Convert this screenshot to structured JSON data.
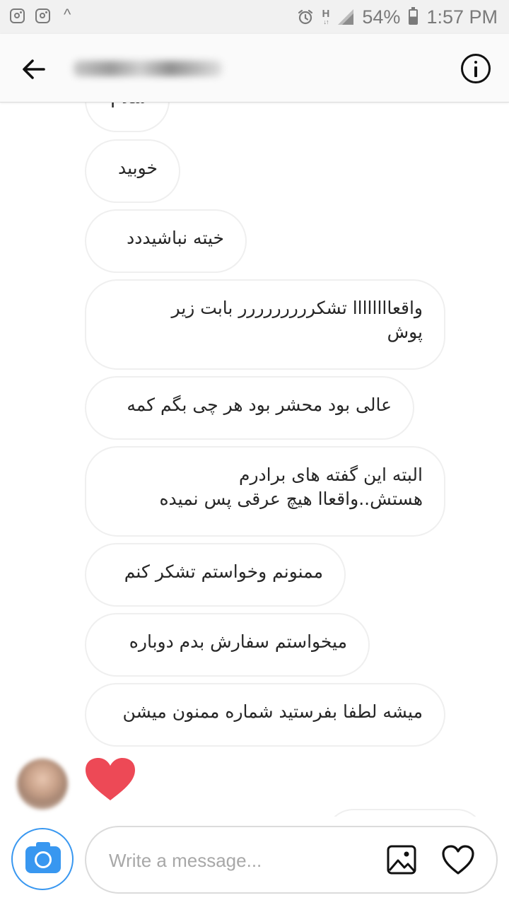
{
  "status_bar": {
    "battery": "54%",
    "time": "1:57 PM",
    "network_type": "H",
    "left_icons": [
      "instagram-icon",
      "instagram-icon",
      "caret-up-icon"
    ],
    "right_icons": [
      "alarm-icon",
      "network-h-icon",
      "signal-icon",
      "battery-icon"
    ]
  },
  "header": {
    "back_icon": "arrow-left-icon",
    "info_icon": "info-icon"
  },
  "messages": [
    {
      "text": "سلام"
    },
    {
      "text": "خوبید"
    },
    {
      "text": "خیته نباشیددد"
    },
    {
      "text": "واقعاااااااا تشکررررررررر بابت زیر\nپوش"
    },
    {
      "text": "عالی بود محشر بود هر چی بگم کمه"
    },
    {
      "text": "البته این گفته های برادرم\nهستش..واقعاا هیچ عرقی پس نمیده"
    },
    {
      "text": "ممنونم وخواستم تشکر کنم"
    },
    {
      "text": "میخواستم سفارش بدم دوباره"
    },
    {
      "text": "میشه لطفا بفرستید شماره ممنون میشن"
    }
  ],
  "reaction": {
    "icon": "heart-icon",
    "color": "#ed4956"
  },
  "composer": {
    "placeholder": "Write a message...",
    "camera_icon": "camera-icon",
    "gallery_icon": "image-icon",
    "like_icon": "heart-outline-icon",
    "accent_color": "#3897f0"
  }
}
